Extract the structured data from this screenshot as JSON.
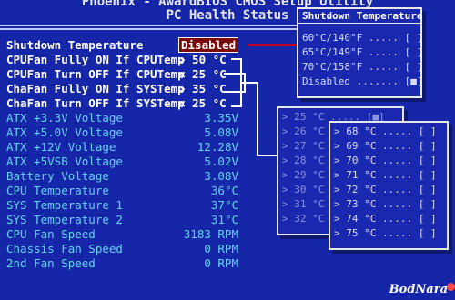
{
  "header": {
    "app_title": "Phoenix - AwardBIOS CMOS Setup Utility",
    "page_title": "PC Health Status"
  },
  "settings": [
    {
      "label": "Shutdown Temperature",
      "value": "Disabled"
    },
    {
      "label": "CPUFan Fully ON If CPUTemp",
      "value": "> 50 °C"
    },
    {
      "label": "CPUFan Turn OFF If CPUTemp",
      "value": "< 25 °C"
    },
    {
      "label": "ChaFan Fully ON If SYSTemp",
      "value": "> 35 °C"
    },
    {
      "label": "ChaFan Turn OFF If SYSTemp",
      "value": "< 25 °C"
    }
  ],
  "readings": [
    {
      "label": "ATX +3.3V Voltage",
      "value": "3.35V"
    },
    {
      "label": "ATX +5.0V Voltage",
      "value": "5.08V"
    },
    {
      "label": "ATX +12V Voltage",
      "value": "12.28V"
    },
    {
      "label": "ATX +5VSB Voltage",
      "value": "5.02V"
    },
    {
      "label": "Battery Voltage",
      "value": "3.08V"
    },
    {
      "label": "CPU Temperature",
      "value": "36°C"
    },
    {
      "label": "SYS Temperature 1",
      "value": "37°C"
    },
    {
      "label": "SYS Temperature 2",
      "value": "31°C"
    },
    {
      "label": "CPU Fan Speed",
      "value": "3183 RPM"
    },
    {
      "label": "Chassis Fan Speed",
      "value": "0 RPM"
    },
    {
      "label": "2nd Fan Speed",
      "value": "0 RPM"
    }
  ],
  "shutdown_popup": {
    "title": "Shutdown Temperature",
    "options": [
      {
        "label": "60°C/140°F ..... [ ]"
      },
      {
        "label": "65°C/149°F ..... [ ]"
      },
      {
        "label": "70°C/158°F ..... [ ]"
      },
      {
        "label": "Disabled ....... [■]"
      }
    ]
  },
  "back_popup": {
    "options": [
      {
        "label": "> 25 °C ..... [■]"
      },
      {
        "label": "> 26 °C ..... [ ]"
      },
      {
        "label": "> 27 °C ..... [ ]"
      },
      {
        "label": "> 28 °C ..... [ ]"
      },
      {
        "label": "> 29 °C ..... [ ]"
      },
      {
        "label": "> 30 °C ..... [ ]"
      },
      {
        "label": "> 31 °C ..... [ ]"
      },
      {
        "label": "> 32 °C ..... [ ]"
      }
    ]
  },
  "front_popup": {
    "options": [
      {
        "label": "> 68 °C ..... [ ]"
      },
      {
        "label": "> 69 °C ..... [ ]"
      },
      {
        "label": "> 70 °C ..... [ ]"
      },
      {
        "label": "> 71 °C ..... [ ]"
      },
      {
        "label": "> 72 °C ..... [ ]"
      },
      {
        "label": "> 73 °C ..... [ ]"
      },
      {
        "label": "> 74 °C ..... [ ]"
      },
      {
        "label": "> 75 °C ..... [ ]"
      }
    ]
  },
  "watermark": "BodNara",
  "colors": {
    "background": "#1626a8",
    "selected_value": "#7a0a0a",
    "dim_text": "#66d2f0",
    "connector_red": "#c0001a"
  }
}
